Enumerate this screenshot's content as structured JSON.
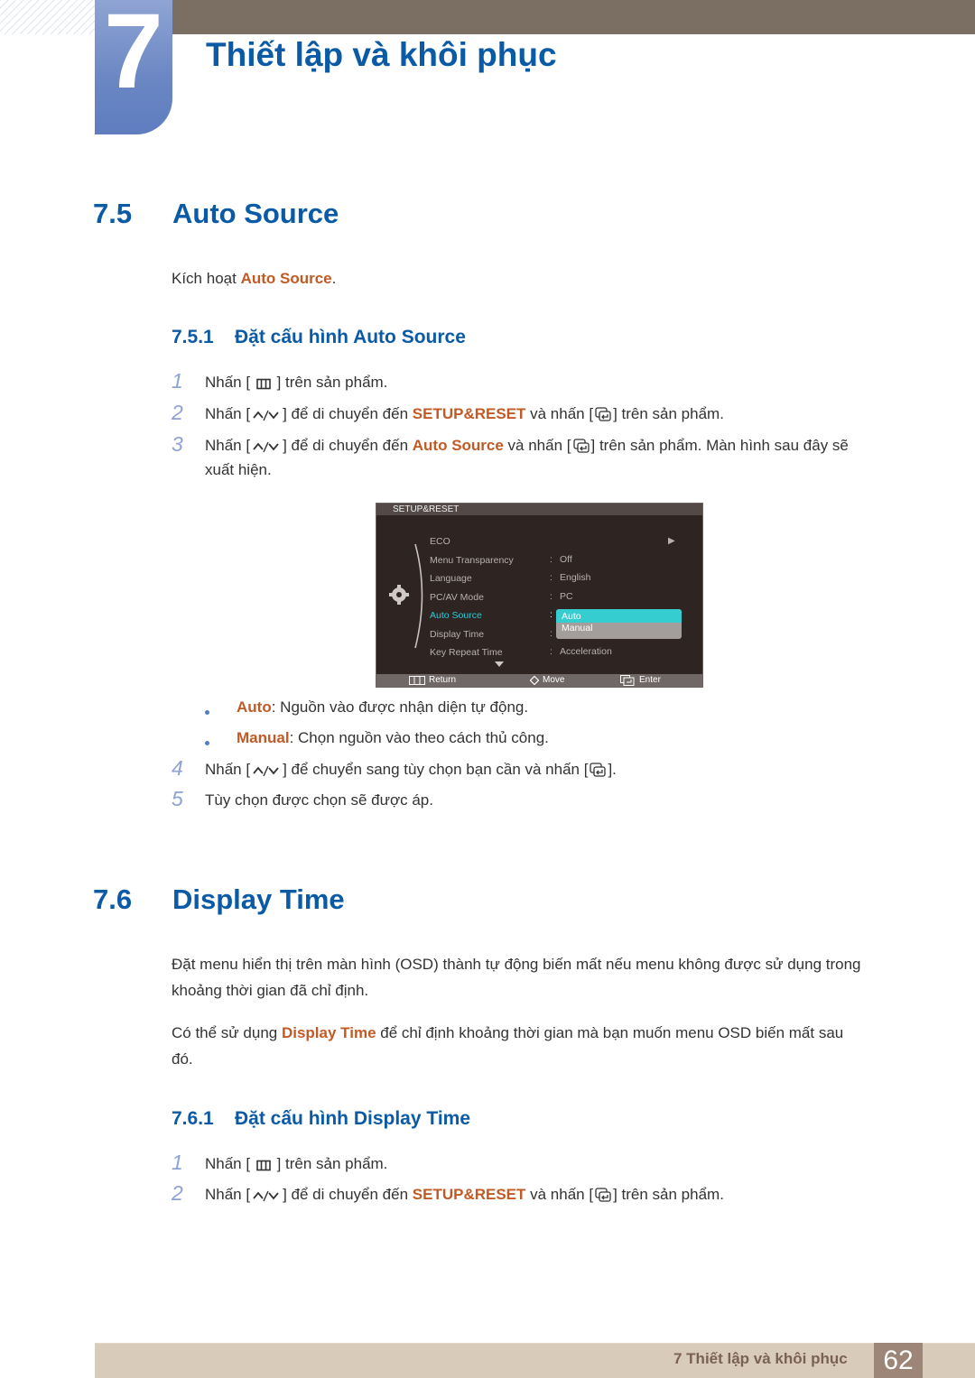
{
  "chapter": {
    "number": "7",
    "title": "Thiết lập và khôi phục"
  },
  "section_7_5": {
    "number": "7.5",
    "title": "Auto Source",
    "intro_prefix": "Kích hoạt ",
    "intro_highlight": "Auto Source",
    "intro_suffix": ".",
    "subsection": {
      "number": "7.5.1",
      "title": "Đặt cấu hình Auto Source"
    },
    "steps": [
      {
        "num": "1",
        "pre": "Nhấn [",
        "icon": "menu-icon",
        "post": "] trên sản phẩm."
      },
      {
        "num": "2",
        "pre": "Nhấn [",
        "icon": "up-down-icon",
        "mid": "] để di chuyển đến ",
        "highlight": "SETUP&RESET",
        "mid2": " và nhấn [",
        "icon2": "enter-icon",
        "post": "] trên sản phẩm."
      },
      {
        "num": "3",
        "pre": "Nhấn [",
        "icon": "up-down-icon",
        "mid": "] để di chuyển đến ",
        "highlight": "Auto Source",
        "mid2": " và nhấn [",
        "icon2": "enter-icon",
        "post": "] trên sản phẩm. Màn hình sau đây sẽ",
        "line2": "xuất hiện."
      },
      {
        "num": "4",
        "pre": "Nhấn [",
        "icon": "up-down-icon",
        "mid": "] để chuyển sang tùy chọn bạn cần và nhấn [",
        "icon2": "enter-icon",
        "post": "]."
      },
      {
        "num": "5",
        "text": "Tùy chọn được chọn sẽ được áp."
      }
    ],
    "bullets": [
      {
        "label": "Auto",
        "text": ": Nguồn vào được nhận diện tự động."
      },
      {
        "label": "Manual",
        "text": ": Chọn nguồn vào theo cách thủ công."
      }
    ]
  },
  "osd": {
    "title": "SETUP&RESET",
    "items": [
      {
        "label": "ECO",
        "value": "",
        "arrow": "▶"
      },
      {
        "label": "Menu Transparency",
        "value": "Off"
      },
      {
        "label": "Language",
        "value": "English"
      },
      {
        "label": "PC/AV Mode",
        "value": "PC"
      },
      {
        "label": "Auto Source",
        "value": "",
        "active": true
      },
      {
        "label": "Display Time",
        "value": ""
      },
      {
        "label": "Key Repeat Time",
        "value": "Acceleration"
      }
    ],
    "dropdown": {
      "selected": "Auto",
      "options": [
        "Auto",
        "Manual"
      ]
    },
    "footer": {
      "return_label": "Return",
      "move_label": "Move",
      "enter_label": "Enter"
    }
  },
  "section_7_6": {
    "number": "7.6",
    "title": "Display Time",
    "para1_line1": "Đặt menu hiển thị trên màn hình (OSD) thành tự động biến mất nếu menu không được sử dụng trong",
    "para1_line2": "khoảng thời gian đã chỉ định.",
    "para2_prefix": "Có thể sử dụng ",
    "para2_highlight": "Display Time",
    "para2_suffix": " để chỉ định khoảng thời gian mà bạn muốn menu OSD biến mất sau",
    "para2_line2": "đó.",
    "subsection": {
      "number": "7.6.1",
      "title": "Đặt cấu hình Display Time"
    },
    "steps": [
      {
        "num": "1",
        "pre": "Nhấn [",
        "post": "] trên sản phẩm."
      },
      {
        "num": "2",
        "pre": "Nhấn [",
        "mid": "] để di chuyển đến ",
        "highlight": "SETUP&RESET",
        "mid2": " và nhấn [",
        "post": "] trên sản phẩm."
      }
    ]
  },
  "footer": {
    "chapter_label": "7 Thiết lập và khôi phục",
    "page_number": "62"
  },
  "colors": {
    "heading_blue": "#0b5aa6",
    "highlight_orange": "#c15a25",
    "osd_active_cyan": "#2ec8d2",
    "header_band": "#7b6e62",
    "footer_band": "#d8cbb9"
  }
}
